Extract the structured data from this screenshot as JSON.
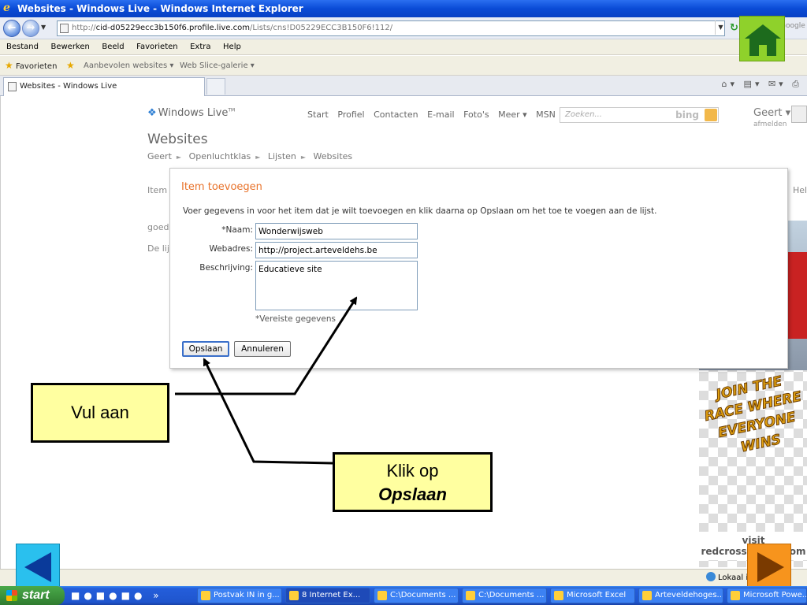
{
  "window": {
    "title": "Websites - Windows Live - Windows Internet Explorer",
    "url_prefix": "http://",
    "url_host": "cid-d05229ecc3b150f6.profile.live.com",
    "url_path": "/Lists/cns!D05229ECC3B150F6!112/",
    "search_provider": "Google"
  },
  "menu": [
    "Bestand",
    "Bewerken",
    "Beeld",
    "Favorieten",
    "Extra",
    "Help"
  ],
  "favorites_bar": {
    "favorites": "Favorieten",
    "suggested": "Aanbevolen websites ▾",
    "web_slice": "Web Slice-galerie ▾"
  },
  "tab": {
    "label": "Websites - Windows Live"
  },
  "site": {
    "logo": "Windows Live",
    "nav": [
      "Start",
      "Profiel",
      "Contacten",
      "E-mail",
      "Foto's",
      "Meer ▾",
      "MSN"
    ],
    "search_placeholder": "Zoeken...",
    "search_brand": "bing",
    "user_name": "Geert ▾",
    "user_sub": "afmelden",
    "page_title": "Websites",
    "breadcrumb": [
      "Geert",
      "Openluchtklas",
      "Lijsten",
      "Websites"
    ],
    "behind_item": "Item t",
    "behind_help": "Help",
    "behind_line1": "goed",
    "behind_line2": "De lijs"
  },
  "ad": {
    "slogan": "JOIN THE RACE WHERE EVERYONE WINS",
    "visit": "visit",
    "domain": "redcrossracing.com"
  },
  "dialog": {
    "title": "Item toevoegen",
    "description": "Voer gegevens in voor het item dat je wilt toevoegen en klik daarna op Opslaan om het toe te voegen aan de lijst.",
    "fields": {
      "name_label": "*Naam:",
      "name_value": "Wonderwijsweb",
      "url_label": "Webadres:",
      "url_value": "http://project.arteveldehs.be",
      "desc_label": "Beschrijving:",
      "desc_value": "Educatieve site"
    },
    "required_note": "*Vereiste gegevens",
    "save": "Opslaan",
    "cancel": "Annuleren"
  },
  "callouts": {
    "fill_in": "Vul aan",
    "click_line1": "Klik op",
    "click_line2": "Opslaan"
  },
  "statusbar": {
    "zone": "Lokaal in"
  },
  "taskbar": {
    "start": "start",
    "overflow": "»",
    "tasks": [
      "Postvak IN in g...",
      "8 Internet Ex...",
      "C:\\Documents ...",
      "C:\\Documents ...",
      "Microsoft Excel",
      "Arteveldehoges...",
      "Microsoft Powe..."
    ]
  },
  "colors": {
    "dialog_title": "#e8722a",
    "callout_fill": "#ffffa0",
    "home_button": "#8fd12b",
    "prev_button": "#2ac0ee",
    "next_button": "#f7941d",
    "taskbar": "#245edb",
    "start_button": "#3a8f3a"
  },
  "icons": {
    "home": "home-icon",
    "prev": "arrow-left-icon",
    "next": "arrow-right-icon",
    "back": "back-arrow-icon",
    "forward": "forward-arrow-icon"
  }
}
